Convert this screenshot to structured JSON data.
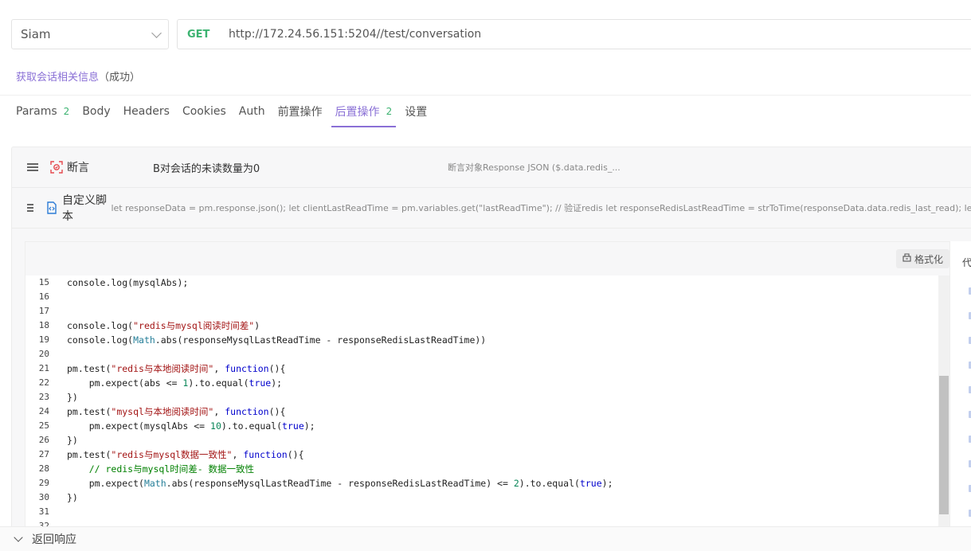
{
  "environment": {
    "selected": "Siam"
  },
  "request": {
    "method": "GET",
    "url": "http://172.24.56.151:5204//test/conversation",
    "name": "获取会话相关信息",
    "status": "（成功）"
  },
  "tabs": [
    {
      "label": "Params",
      "count": "2"
    },
    {
      "label": "Body",
      "count": ""
    },
    {
      "label": "Headers",
      "count": ""
    },
    {
      "label": "Cookies",
      "count": ""
    },
    {
      "label": "Auth",
      "count": ""
    },
    {
      "label": "前置操作",
      "count": ""
    },
    {
      "label": "后置操作",
      "count": "2",
      "active": true
    },
    {
      "label": "设置",
      "count": ""
    }
  ],
  "post_ops": [
    {
      "type": "断言",
      "icon": "assertion-icon",
      "value": "B对会话的未读数量为0",
      "desc": "断言对象Response JSON ($.data.redis_..."
    },
    {
      "type": "自定义脚本",
      "icon": "script-icon",
      "value": "",
      "desc": "let responseData = pm.response.json(); let clientLastReadTime = pm.variables.get(\"lastReadTime\"); // 验证redis let responseRedisLastReadTime = strToTime(responseData.data.redis_last_read); let a"
    }
  ],
  "editor": {
    "format_label": "格式化",
    "side_title": "代",
    "lines": [
      {
        "n": "15",
        "tokens": [
          [
            "",
            "console.log(mysqlAbs);"
          ]
        ]
      },
      {
        "n": "16",
        "tokens": []
      },
      {
        "n": "17",
        "tokens": []
      },
      {
        "n": "18",
        "tokens": [
          [
            "",
            "console.log("
          ],
          [
            "str",
            "\"redis与mysql阅读时间差\""
          ],
          [
            "",
            ")"
          ]
        ]
      },
      {
        "n": "19",
        "tokens": [
          [
            "",
            "console.log("
          ],
          [
            "obj",
            "Math"
          ],
          [
            "",
            ".abs(responseMysqlLastReadTime - responseRedisLastReadTime))"
          ]
        ]
      },
      {
        "n": "20",
        "tokens": []
      },
      {
        "n": "21",
        "tokens": [
          [
            "",
            "pm.test("
          ],
          [
            "str",
            "\"redis与本地阅读时间\""
          ],
          [
            "",
            ", "
          ],
          [
            "kw",
            "function"
          ],
          [
            "",
            "(){"
          ]
        ]
      },
      {
        "n": "22",
        "tokens": [
          [
            "",
            "    pm.expect(abs <= "
          ],
          [
            "num",
            "1"
          ],
          [
            "",
            ").to.equal("
          ],
          [
            "kw",
            "true"
          ],
          [
            "",
            ");"
          ]
        ]
      },
      {
        "n": "23",
        "tokens": [
          [
            "",
            "})"
          ]
        ]
      },
      {
        "n": "24",
        "tokens": [
          [
            "",
            "pm.test("
          ],
          [
            "str",
            "\"mysql与本地阅读时间\""
          ],
          [
            "",
            ", "
          ],
          [
            "kw",
            "function"
          ],
          [
            "",
            "(){"
          ]
        ]
      },
      {
        "n": "25",
        "tokens": [
          [
            "",
            "    pm.expect(mysqlAbs <= "
          ],
          [
            "num",
            "10"
          ],
          [
            "",
            ").to.equal("
          ],
          [
            "kw",
            "true"
          ],
          [
            "",
            ");"
          ]
        ]
      },
      {
        "n": "26",
        "tokens": [
          [
            "",
            "})"
          ]
        ]
      },
      {
        "n": "27",
        "tokens": [
          [
            "",
            "pm.test("
          ],
          [
            "str",
            "\"redis与mysql数据一致性\""
          ],
          [
            "",
            ", "
          ],
          [
            "kw",
            "function"
          ],
          [
            "",
            "(){"
          ]
        ]
      },
      {
        "n": "28",
        "tokens": [
          [
            "",
            "    "
          ],
          [
            "comment",
            "// redis与mysql时间差- 数据一致性"
          ]
        ]
      },
      {
        "n": "29",
        "tokens": [
          [
            "",
            "    pm.expect("
          ],
          [
            "obj",
            "Math"
          ],
          [
            "",
            ".abs(responseMysqlLastReadTime - responseRedisLastReadTime) <= "
          ],
          [
            "num",
            "2"
          ],
          [
            "",
            ").to.equal("
          ],
          [
            "kw",
            "true"
          ],
          [
            "",
            ");"
          ]
        ]
      },
      {
        "n": "30",
        "tokens": [
          [
            "",
            "})"
          ]
        ]
      },
      {
        "n": "31",
        "tokens": []
      },
      {
        "n": "32",
        "tokens": []
      }
    ]
  },
  "bottom": {
    "label": "返回响应"
  }
}
